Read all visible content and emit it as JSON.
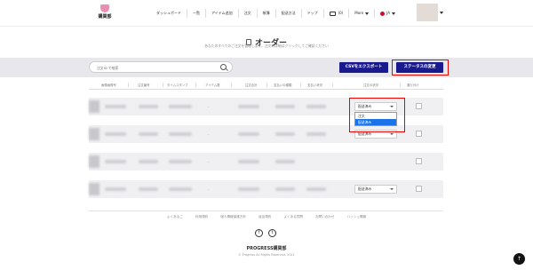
{
  "header": {
    "logo_text": "購買部",
    "nav": [
      "ダッシュボード",
      "一覧",
      "アイテム追加",
      "注文",
      "帳簿",
      "配送方法",
      "ドップ"
    ],
    "messages_count": "(0)",
    "more_label": "More",
    "lang_label": "JA"
  },
  "page": {
    "title": "オーダー",
    "subtitle": "あなたのすべてのご注文を管理します。注文の詳細はクリックしてご確認ください"
  },
  "toolbar": {
    "search_placeholder": "注文ID で検索",
    "csv_label": "CSVをエクスポート",
    "status_label": "ステータスの変更"
  },
  "table": {
    "columns": [
      "画像画像号",
      "注文番号",
      "タイムスタンプ",
      "アイテム数",
      "注文合計",
      "支払いの種類",
      "支払い状況",
      "注文の状況",
      "選び分け"
    ],
    "rows": [
      {
        "status": "配送済み",
        "dash": "-"
      },
      {
        "status": "配送済み",
        "dash": "-"
      },
      {
        "status": "",
        "dash": "-"
      },
      {
        "status": "配送済み",
        "dash": "-"
      }
    ],
    "dropdown_options": [
      "注文",
      "配送済み"
    ]
  },
  "footer": {
    "links": [
      "よくあるご",
      "利用規約",
      "個人情報保護方針",
      "返品規約",
      "よくある質問",
      "お問い合わせ",
      "ハッシュ情報"
    ],
    "brand": "PROGRESS購買部",
    "copyright": "© Progress All Rights Reserved. 2021"
  }
}
